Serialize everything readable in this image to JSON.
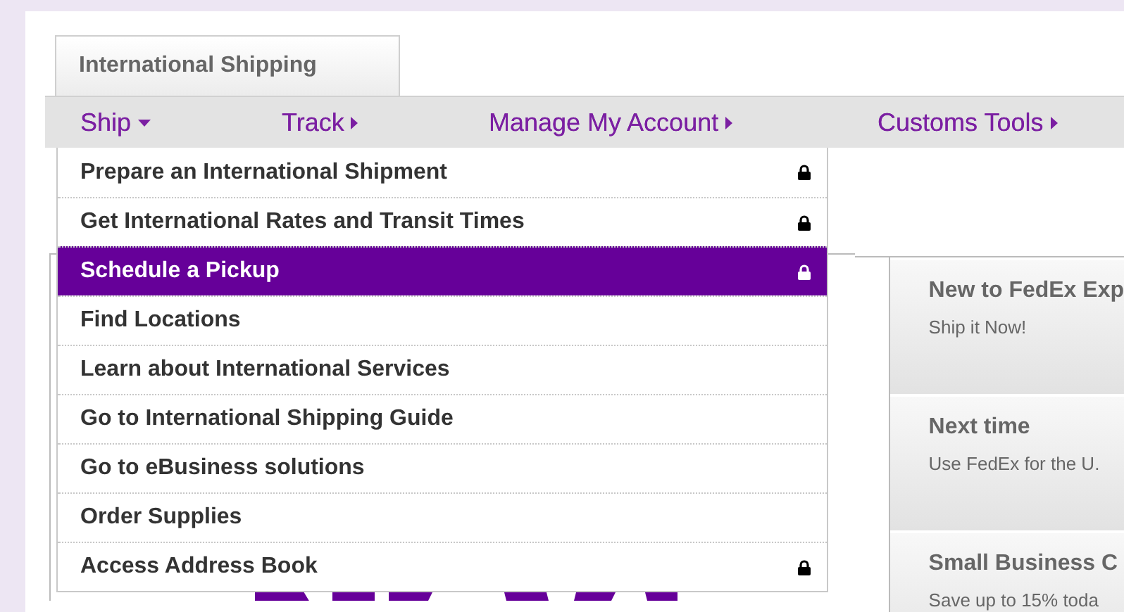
{
  "tab": {
    "label": "International Shipping",
    "selected": true
  },
  "nav": [
    {
      "label": "Ship",
      "expanded": true
    },
    {
      "label": "Track",
      "expanded": false
    },
    {
      "label": "Manage My Account",
      "expanded": false
    },
    {
      "label": "Customs Tools",
      "expanded": false
    }
  ],
  "dropdown": [
    {
      "label": "Prepare an International Shipment",
      "locked": true,
      "selected": false
    },
    {
      "label": "Get International Rates and Transit Times",
      "locked": true,
      "selected": false
    },
    {
      "label": "Schedule a Pickup",
      "locked": true,
      "selected": true
    },
    {
      "label": "Find Locations",
      "locked": false,
      "selected": false
    },
    {
      "label": "Learn about International Services",
      "locked": false,
      "selected": false
    },
    {
      "label": "Go to International Shipping Guide",
      "locked": false,
      "selected": false
    },
    {
      "label": "Go to eBusiness solutions",
      "locked": false,
      "selected": false
    },
    {
      "label": "Order Supplies",
      "locked": false,
      "selected": false
    },
    {
      "label": "Access Address Book",
      "locked": true,
      "selected": false
    }
  ],
  "promos": [
    {
      "title": "New to FedEx Exp",
      "text": "Ship it Now!"
    },
    {
      "title": "Next time",
      "text": "Use FedEx for the U."
    },
    {
      "title": "Small Business C",
      "text": "Save up to 15% toda"
    }
  ]
}
